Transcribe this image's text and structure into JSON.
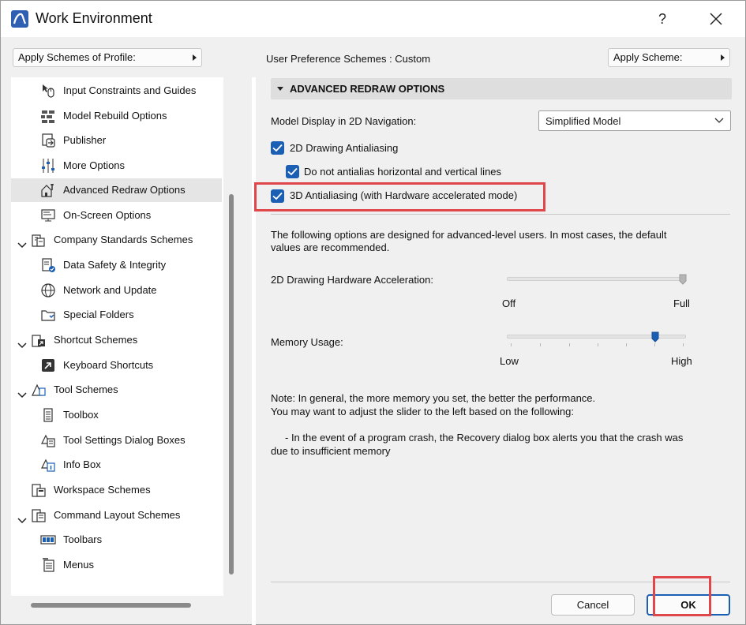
{
  "window": {
    "title": "Work Environment",
    "help_label": "?"
  },
  "top": {
    "apply_profile_label": "Apply Schemes of Profile:",
    "scheme_label": "User Preference Schemes :  Custom",
    "apply_scheme_label": "Apply Scheme:"
  },
  "tree": {
    "items": [
      {
        "label": "Input Constraints and Guides",
        "icon": "mouse-cursor-icon"
      },
      {
        "label": "Model Rebuild Options",
        "icon": "bricks-icon"
      },
      {
        "label": "Publisher",
        "icon": "publisher-icon"
      },
      {
        "label": "More Options",
        "icon": "sliders-icon"
      },
      {
        "label": "Advanced Redraw Options",
        "icon": "house-wrench-icon"
      },
      {
        "label": "On-Screen Options",
        "icon": "monitor-icon"
      },
      {
        "label": "Company Standards Schemes",
        "icon": "building-icon"
      },
      {
        "label": "Data Safety & Integrity",
        "icon": "document-shield-icon"
      },
      {
        "label": "Network and Update",
        "icon": "globe-icon"
      },
      {
        "label": "Special Folders",
        "icon": "folder-icon"
      },
      {
        "label": "Shortcut Schemes",
        "icon": "shortcut-scheme-icon"
      },
      {
        "label": "Keyboard Shortcuts",
        "icon": "shortcut-arrow-icon"
      },
      {
        "label": "Tool Schemes",
        "icon": "tools-icon"
      },
      {
        "label": "Toolbox",
        "icon": "toolbox-icon"
      },
      {
        "label": "Tool Settings Dialog Boxes",
        "icon": "tool-settings-icon"
      },
      {
        "label": "Info Box",
        "icon": "info-box-icon"
      },
      {
        "label": "Workspace Schemes",
        "icon": "workspace-icon"
      },
      {
        "label": "Command Layout Schemes",
        "icon": "command-layout-icon"
      },
      {
        "label": "Toolbars",
        "icon": "toolbar-icon"
      },
      {
        "label": "Menus",
        "icon": "menu-icon"
      }
    ],
    "selected": "Advanced Redraw Options"
  },
  "panel": {
    "section_title": "ADVANCED REDRAW OPTIONS",
    "model_display_label": "Model Display in 2D Navigation:",
    "model_display_value": "Simplified Model",
    "check_2d_antialias": "2D Drawing Antialiasing",
    "check_no_hv": "Do not antialias horizontal and vertical lines",
    "check_3d_antialias": "3D Antialiasing (with Hardware accelerated mode)",
    "info_line1": "The following options are designed for advanced-level users. In most cases, the default",
    "info_line2": "values are recommended.",
    "hw_accel_label": "2D Drawing Hardware Acceleration:",
    "hw_off": "Off",
    "hw_full": "Full",
    "hw_level": 1.0,
    "memory_label": "Memory Usage:",
    "mem_low": "Low",
    "mem_high": "High",
    "mem_level": 0.83,
    "note_line1": "Note: In general, the more memory you set, the better the performance.",
    "note_line2": "You may want to adjust the slider to the left based on the following:",
    "note_line3": "- In the event of a program crash, the Recovery dialog box alerts you that the crash was",
    "note_line4": "due to insufficient memory"
  },
  "footer": {
    "cancel_label": "Cancel",
    "ok_label": "OK"
  },
  "colors": {
    "accent": "#1a5fb4",
    "highlight": "#e0474b"
  }
}
